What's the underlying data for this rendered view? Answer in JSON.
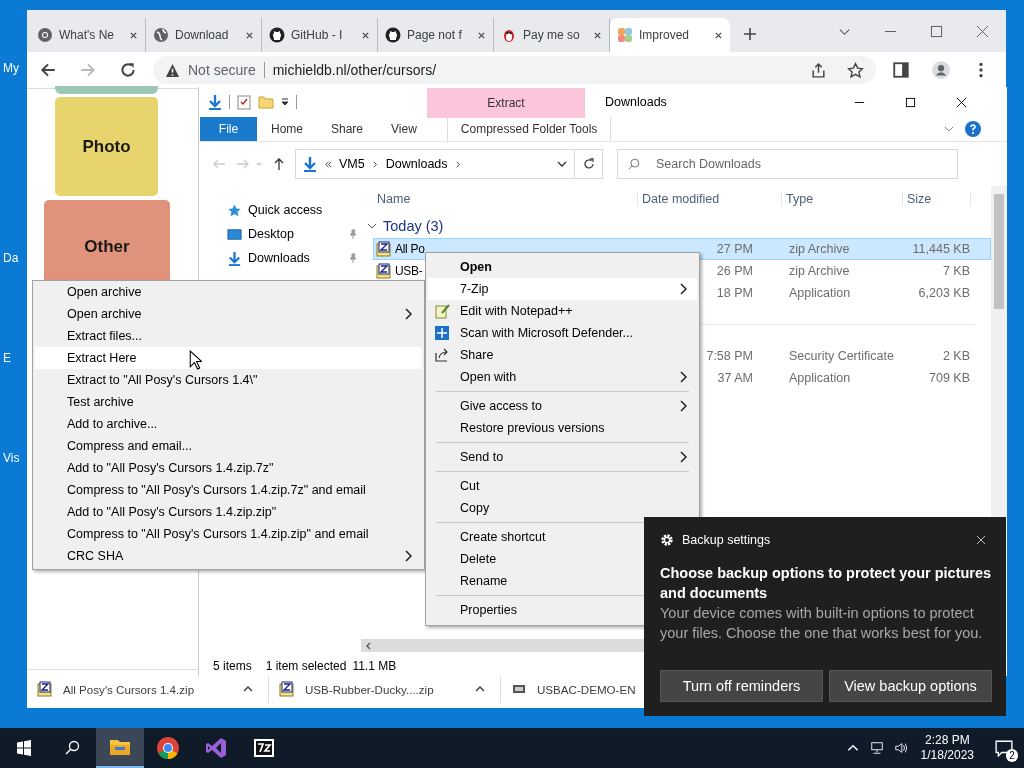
{
  "desktop": {
    "icon_labels": [
      "My",
      "Da",
      "E",
      "Vis"
    ]
  },
  "browser": {
    "tabs": [
      {
        "label": "What's Ne",
        "selected": false
      },
      {
        "label": "Download",
        "selected": false
      },
      {
        "label": "GitHub - I",
        "selected": false
      },
      {
        "label": "Page not f",
        "selected": false
      },
      {
        "label": "Pay me so",
        "selected": false
      },
      {
        "label": "Improved",
        "selected": true
      }
    ],
    "security": "Not secure",
    "url": "michieldb.nl/other/cursors/",
    "cards": [
      {
        "label": "Photo",
        "color": "#e8d46c"
      },
      {
        "label": "Other",
        "color": "#e0937a"
      }
    ],
    "downloads": [
      {
        "name": "All Posy's Cursors 1.4.zip"
      },
      {
        "name": "USB-Rubber-Ducky....zip"
      },
      {
        "name": "USBAC-DEMO-EN"
      }
    ]
  },
  "explorer": {
    "title": "Downloads",
    "context_tab": "Extract",
    "file_tab": "File",
    "ribbon_tabs": [
      "Home",
      "Share",
      "View",
      "Compressed Folder Tools"
    ],
    "breadcrumb": [
      "VM5",
      "Downloads"
    ],
    "search_placeholder": "Search Downloads",
    "nav": [
      {
        "label": "Quick access",
        "pinned": false
      },
      {
        "label": "Desktop",
        "pinned": true
      },
      {
        "label": "Downloads",
        "pinned": true
      }
    ],
    "columns": [
      "Name",
      "Date modified",
      "Type",
      "Size"
    ],
    "groups": [
      {
        "label": "Today (3)",
        "expanded": true,
        "rows": [
          {
            "name": "All Po",
            "date": "27 PM",
            "type": "zip Archive",
            "size": "11,445 KB",
            "selected": true
          },
          {
            "name": "USB-",
            "date": "26 PM",
            "type": "zip Archive",
            "size": "7 KB",
            "selected": false
          },
          {
            "date": "18 PM",
            "type": "Application",
            "size": "6,203 KB",
            "selected": false
          }
        ]
      },
      {
        "rows": [
          {
            "date": "7:58 PM",
            "type": "Security Certificate",
            "size": "2 KB",
            "selected": false
          },
          {
            "date": "37 AM",
            "type": "Application",
            "size": "709 KB",
            "selected": false
          }
        ]
      }
    ],
    "status": {
      "count": "5 items",
      "selection": "1 item selected",
      "size": "11.1 MB"
    }
  },
  "context_menu": [
    {
      "kind": "item",
      "label": "Open",
      "default": true,
      "submenu": false,
      "selected": false
    },
    {
      "kind": "item",
      "label": "7-Zip",
      "default": false,
      "submenu": true,
      "selected": true
    },
    {
      "kind": "item",
      "label": "Edit with Notepad++",
      "default": false,
      "submenu": false,
      "selected": false
    },
    {
      "kind": "item",
      "label": "Scan with Microsoft Defender...",
      "default": false,
      "submenu": false,
      "selected": false
    },
    {
      "kind": "item",
      "label": "Share",
      "default": false,
      "submenu": false,
      "selected": false
    },
    {
      "kind": "item",
      "label": "Open with",
      "default": false,
      "submenu": true,
      "selected": false
    },
    {
      "kind": "separator"
    },
    {
      "kind": "item",
      "label": "Give access to",
      "default": false,
      "submenu": true,
      "selected": false
    },
    {
      "kind": "item",
      "label": "Restore previous versions",
      "default": false,
      "submenu": false,
      "selected": false
    },
    {
      "kind": "separator"
    },
    {
      "kind": "item",
      "label": "Send to",
      "default": false,
      "submenu": true,
      "selected": false
    },
    {
      "kind": "separator"
    },
    {
      "kind": "item",
      "label": "Cut",
      "default": false,
      "submenu": false,
      "selected": false
    },
    {
      "kind": "item",
      "label": "Copy",
      "default": false,
      "submenu": false,
      "selected": false
    },
    {
      "kind": "separator"
    },
    {
      "kind": "item",
      "label": "Create shortcut",
      "default": false,
      "selected": false
    },
    {
      "kind": "item",
      "label": "Delete",
      "default": false,
      "selected": false
    },
    {
      "kind": "item",
      "label": "Rename",
      "default": false,
      "selected": false
    },
    {
      "kind": "separator"
    },
    {
      "kind": "item",
      "label": "Properties",
      "default": false,
      "selected": false
    }
  ],
  "zip_submenu": [
    {
      "label": "Open archive",
      "submenu": false,
      "selected": false
    },
    {
      "label": "Open archive",
      "submenu": true,
      "selected": false
    },
    {
      "label": "Extract files...",
      "submenu": false,
      "selected": false
    },
    {
      "label": "Extract Here",
      "submenu": false,
      "selected": true
    },
    {
      "label": "Extract to \"All Posy's Cursors 1.4\\\"",
      "submenu": false,
      "selected": false
    },
    {
      "label": "Test archive",
      "submenu": false,
      "selected": false
    },
    {
      "label": "Add to archive...",
      "submenu": false,
      "selected": false
    },
    {
      "label": "Compress and email...",
      "submenu": false,
      "selected": false
    },
    {
      "label": "Add to \"All Posy's Cursors 1.4.zip.7z\"",
      "submenu": false,
      "selected": false
    },
    {
      "label": "Compress to \"All Posy's Cursors 1.4.zip.7z\" and email",
      "submenu": false,
      "selected": false
    },
    {
      "label": "Add to \"All Posy's Cursors 1.4.zip.zip\"",
      "submenu": false,
      "selected": false
    },
    {
      "label": "Compress to \"All Posy's Cursors 1.4.zip.zip\" and email",
      "submenu": false,
      "selected": false
    },
    {
      "label": "CRC SHA",
      "submenu": true,
      "selected": false
    }
  ],
  "toast": {
    "app": "Backup settings",
    "title": "Choose backup options to protect your pictures and documents",
    "body": "Your device comes with built-in options to protect your files. Choose the one that works best for you.",
    "buttons": [
      "Turn off reminders",
      "View backup options"
    ]
  },
  "taskbar": {
    "apps": [
      {
        "selected": true
      },
      {
        "selected": false
      },
      {
        "selected": false
      },
      {
        "selected": false
      }
    ],
    "time": "2:28 PM",
    "date": "1/18/2023",
    "notifications": "2"
  }
}
